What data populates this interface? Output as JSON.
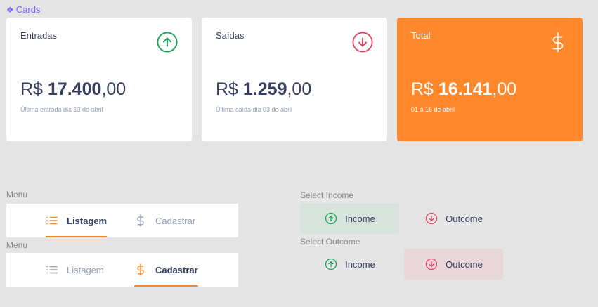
{
  "section": {
    "icon": "diamond-icon",
    "label": "Cards"
  },
  "colors": {
    "accent": "#ff872c",
    "income": "#12a454",
    "outcome": "#e83f5b",
    "text": "#363f5f",
    "muted": "#969cb3",
    "figma_purple": "#7b61ff"
  },
  "cards": [
    {
      "title": "Entradas",
      "icon": "arrow-up-circle-icon",
      "currency": "R$ ",
      "amount_int": "17.400",
      "amount_dec": ",00",
      "sub": "Última entrada dia 13 de abril"
    },
    {
      "title": "Saídas",
      "icon": "arrow-down-circle-icon",
      "currency": "R$ ",
      "amount_int": "1.259",
      "amount_dec": ",00",
      "sub": "Última saída dia 03 de abril"
    },
    {
      "title": "Total",
      "icon": "dollar-sign-icon",
      "currency": "R$ ",
      "amount_int": "16.141",
      "amount_dec": ",00",
      "sub": "01 à 16 de abril"
    }
  ],
  "menus": [
    {
      "label": "Menu",
      "items": [
        {
          "label": "Listagem",
          "icon": "list-icon",
          "active": true
        },
        {
          "label": "Cadastrar",
          "icon": "dollar-sign-icon",
          "active": false
        }
      ]
    },
    {
      "label": "Menu",
      "items": [
        {
          "label": "Listagem",
          "icon": "list-icon",
          "active": false
        },
        {
          "label": "Cadastrar",
          "icon": "dollar-sign-icon",
          "active": true
        }
      ]
    }
  ],
  "selects": [
    {
      "label": "Select Income",
      "income": "Income",
      "outcome": "Outcome",
      "selected": "income"
    },
    {
      "label": "Select Outcome",
      "income": "Income",
      "outcome": "Outcome",
      "selected": "outcome"
    }
  ]
}
